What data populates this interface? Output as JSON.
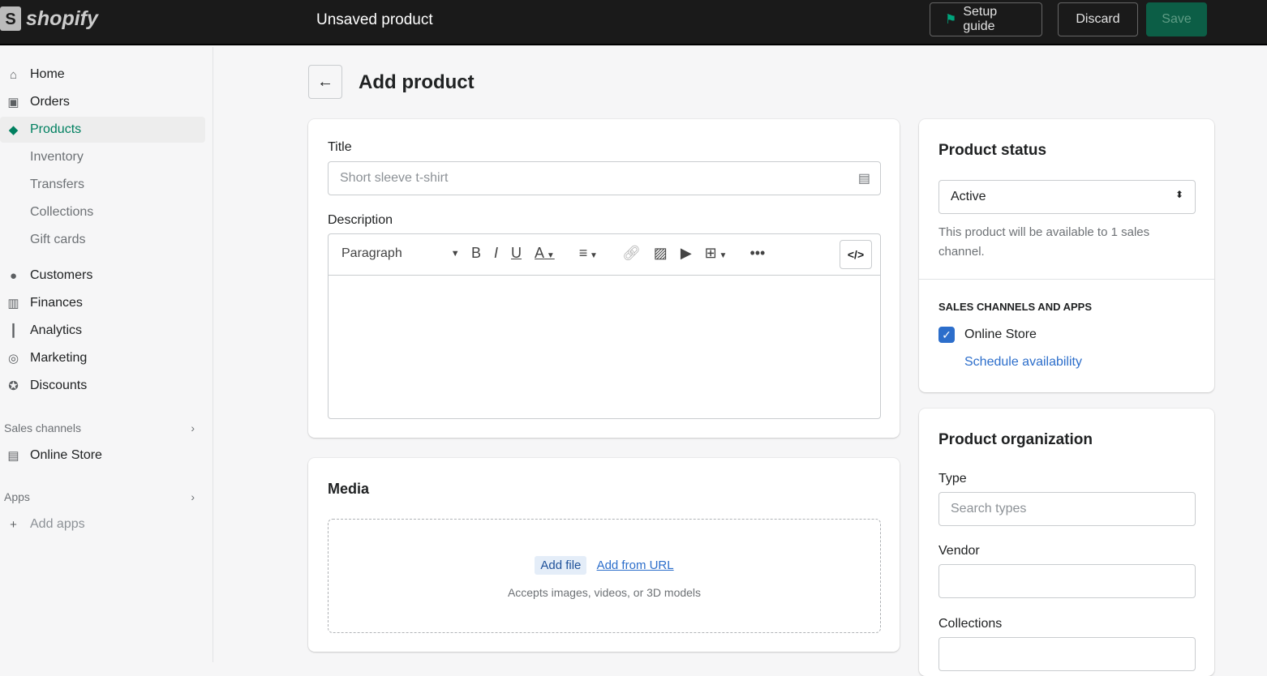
{
  "topbar": {
    "brand": "shopify",
    "title": "Unsaved product",
    "setup_guide": "Setup guide",
    "discard": "Discard",
    "save": "Save"
  },
  "sidebar": {
    "items": [
      {
        "label": "Home",
        "icon": "⌂"
      },
      {
        "label": "Orders",
        "icon": "▣"
      },
      {
        "label": "Products",
        "icon": "◆"
      },
      {
        "label": "Inventory"
      },
      {
        "label": "Transfers"
      },
      {
        "label": "Collections"
      },
      {
        "label": "Gift cards"
      },
      {
        "label": "Customers",
        "icon": "●"
      },
      {
        "label": "Finances",
        "icon": "▥"
      },
      {
        "label": "Analytics",
        "icon": "┃"
      },
      {
        "label": "Marketing",
        "icon": "◎"
      },
      {
        "label": "Discounts",
        "icon": "✪"
      }
    ],
    "sales_channels": "Sales channels",
    "online_store": "Online Store",
    "apps": "Apps",
    "add_apps": "Add apps"
  },
  "page": {
    "title": "Add product"
  },
  "main": {
    "title_label": "Title",
    "title_placeholder": "Short sleeve t-shirt",
    "description_label": "Description",
    "paragraph": "Paragraph",
    "media": {
      "title": "Media",
      "add_file": "Add file",
      "add_url": "Add from URL",
      "hint": "Accepts images, videos, or 3D models"
    }
  },
  "status": {
    "title": "Product status",
    "value": "Active",
    "note": "This product will be available to 1 sales channel.",
    "channels_heading": "SALES CHANNELS AND APPS",
    "channel": "Online Store",
    "channel_checked": true,
    "schedule": "Schedule availability"
  },
  "org": {
    "title": "Product organization",
    "type_label": "Type",
    "type_placeholder": "Search types",
    "vendor_label": "Vendor",
    "collections_label": "Collections"
  },
  "colors": {
    "accent": "#008060",
    "link": "#2c6ecb",
    "topbar": "#1a1a1a"
  }
}
